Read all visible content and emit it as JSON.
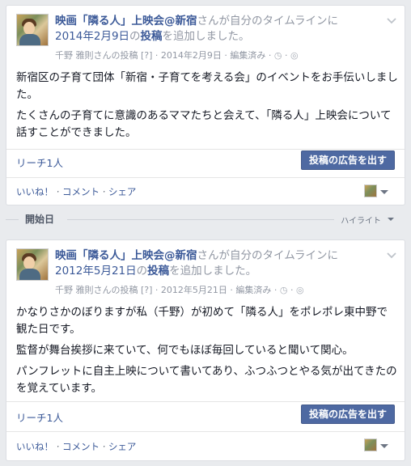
{
  "colors": {
    "link": "#3b5998",
    "boost_button": "#4e69a2",
    "background": "#e9ebee"
  },
  "posts": [
    {
      "page_name": "映画「隣る人」上映会@新宿",
      "headline_mid": "さんが自分のタイムラインに",
      "date_link": "2014年2月9日",
      "headline_no": "の",
      "post_word": "投稿",
      "headline_end": "を追加しました。",
      "meta_author": "千野 雅則さんの投稿",
      "meta_q": "[?]",
      "meta_date": "2014年2月9日",
      "meta_edited": "編集済み",
      "paragraphs": [
        "新宿区の子育て団体「新宿・子育てを考える会」のイベントをお手伝いしました。",
        "たくさんの子育てに意識のあるママたちと会えて、「隣る人」上映会について話すことができました。"
      ],
      "reach": "リーチ1人",
      "boost": "投稿の広告を出す",
      "actions": {
        "like": "いいね！",
        "comment": "コメント",
        "share": "シェア"
      }
    },
    {
      "page_name": "映画「隣る人」上映会@新宿",
      "headline_mid": "さんが自分のタイムラインに",
      "date_link": "2012年5月21日",
      "headline_no": "の",
      "post_word": "投稿",
      "headline_end": "を追加しました。",
      "meta_author": "千野 雅則さんの投稿",
      "meta_q": "[?]",
      "meta_date": "2012年5月21日",
      "meta_edited": "編集済み",
      "paragraphs": [
        "かなりさかのぼりますが私（千野）が初めて「隣る人」をポレポレ東中野で観た日です。",
        "監督が舞台挨拶に来ていて、何でもほぼ毎回していると聞いて関心。",
        "パンフレットに自主上映について書いてあり、ふつふつとやる気が出てきたのを覚えています。"
      ],
      "reach": "リーチ1人",
      "boost": "投稿の広告を出す",
      "actions": {
        "like": "いいね！",
        "comment": "コメント",
        "share": "シェア"
      }
    }
  ],
  "separator": {
    "label": "開始日",
    "highlight": "ハイライト"
  },
  "icons": {
    "chevron": "chevron-down-icon",
    "globe": "globe-icon",
    "clock": "clock-icon",
    "audience": "audience-selector-icon"
  }
}
